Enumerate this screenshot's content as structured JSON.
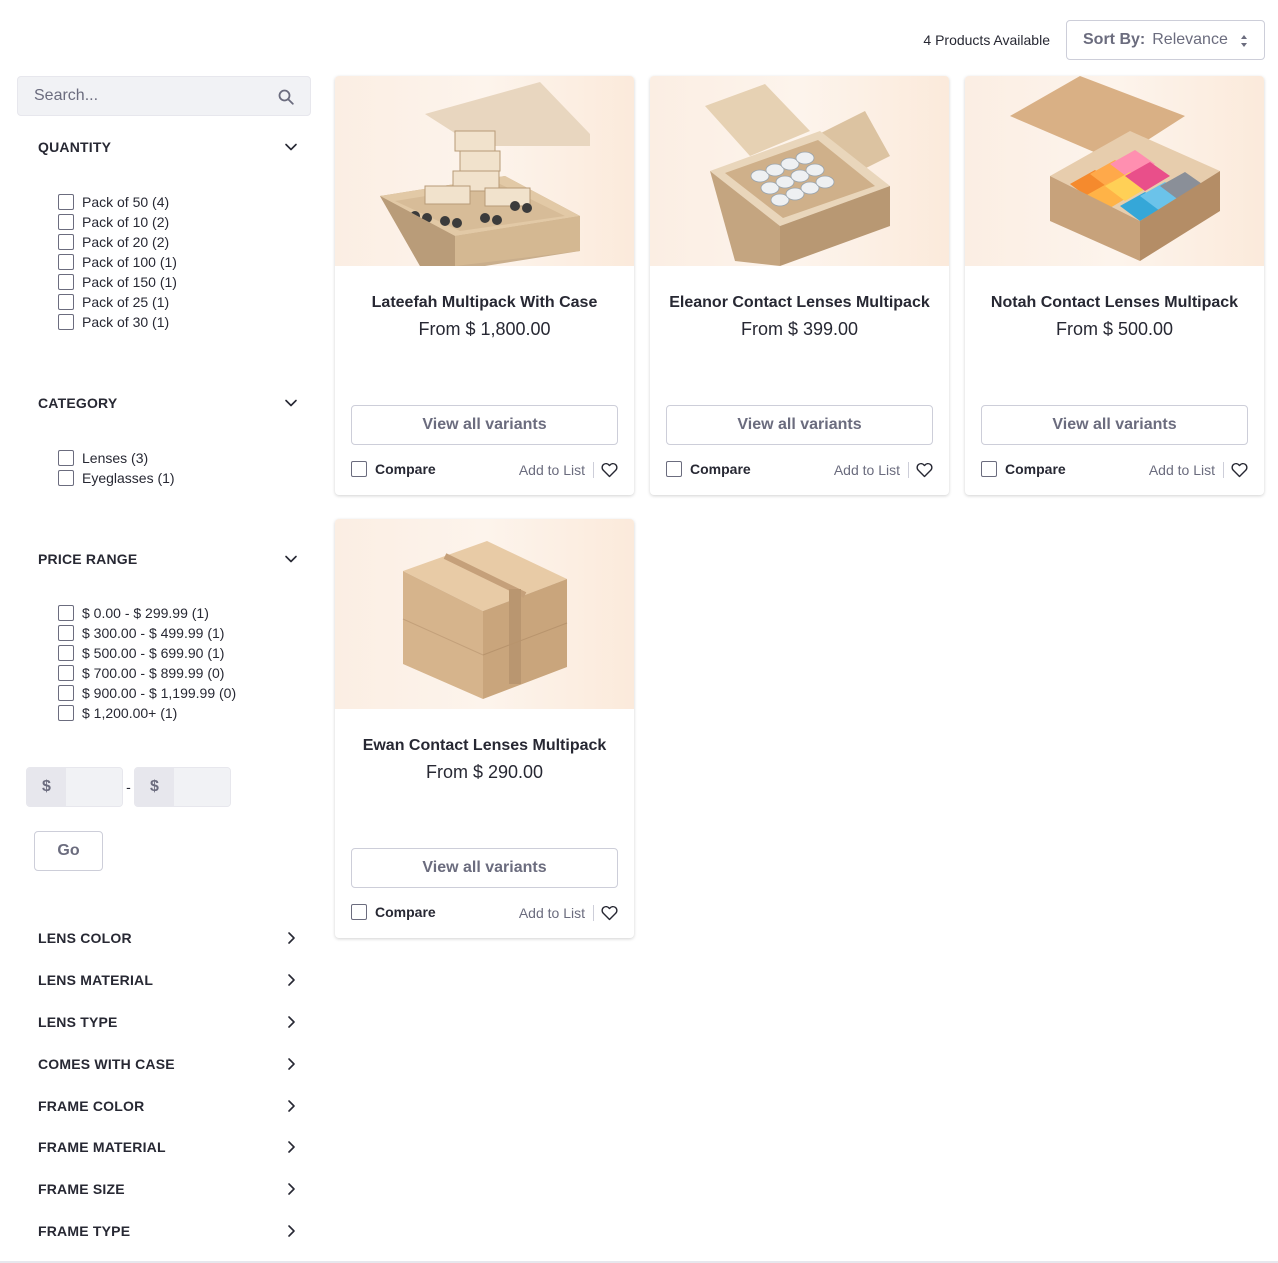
{
  "header": {
    "count_text": "4 Products Available",
    "sort_label": "Sort By:",
    "sort_value": "Relevance"
  },
  "search": {
    "placeholder": "Search..."
  },
  "facets": {
    "quantity": {
      "title": "QUANTITY",
      "options": [
        "Pack of 50 (4)",
        "Pack of 10 (2)",
        "Pack of 20 (2)",
        "Pack of 100 (1)",
        "Pack of 150 (1)",
        "Pack of 25 (1)",
        "Pack of 30 (1)"
      ]
    },
    "category": {
      "title": "CATEGORY",
      "options": [
        "Lenses (3)",
        "Eyeglasses (1)"
      ]
    },
    "price_range": {
      "title": "PRICE RANGE",
      "options": [
        "$ 0.00 - $ 299.99 (1)",
        "$ 300.00 - $ 499.99 (1)",
        "$ 500.00 - $ 699.90 (1)",
        "$ 700.00 - $ 899.99 (0)",
        "$ 900.00 - $ 1,199.99 (0)",
        "$ 1,200.00+ (1)"
      ],
      "currency": "$",
      "dash": "-",
      "go_label": "Go"
    },
    "collapsed": [
      "LENS COLOR",
      "LENS MATERIAL",
      "LENS TYPE",
      "COMES WITH CASE",
      "FRAME COLOR",
      "FRAME MATERIAL",
      "FRAME SIZE",
      "FRAME TYPE"
    ]
  },
  "products": [
    {
      "name": "Lateefah Multipack With Case",
      "price": "From $ 1,800.00",
      "view_label": "View all variants",
      "compare_label": "Compare",
      "add_label": "Add to List",
      "image": "box-with-eyeglasses"
    },
    {
      "name": "Eleanor Contact Lenses Multipack",
      "price": "From $ 399.00",
      "view_label": "View all variants",
      "compare_label": "Compare",
      "add_label": "Add to List",
      "image": "box-with-lens-cases"
    },
    {
      "name": "Notah Contact Lenses Multipack",
      "price": "From $ 500.00",
      "view_label": "View all variants",
      "compare_label": "Compare",
      "add_label": "Add to List",
      "image": "box-with-colorful-lens-cases"
    },
    {
      "name": "Ewan Contact Lenses Multipack",
      "price": "From $ 290.00",
      "view_label": "View all variants",
      "compare_label": "Compare",
      "add_label": "Add to List",
      "image": "sealed-cardboard-box"
    }
  ],
  "colors": {
    "text": "#272833",
    "muted": "#6b6c7e",
    "border": "#cdced9",
    "input_bg": "#f1f2f5",
    "image_bg": "#fdf4ec"
  }
}
